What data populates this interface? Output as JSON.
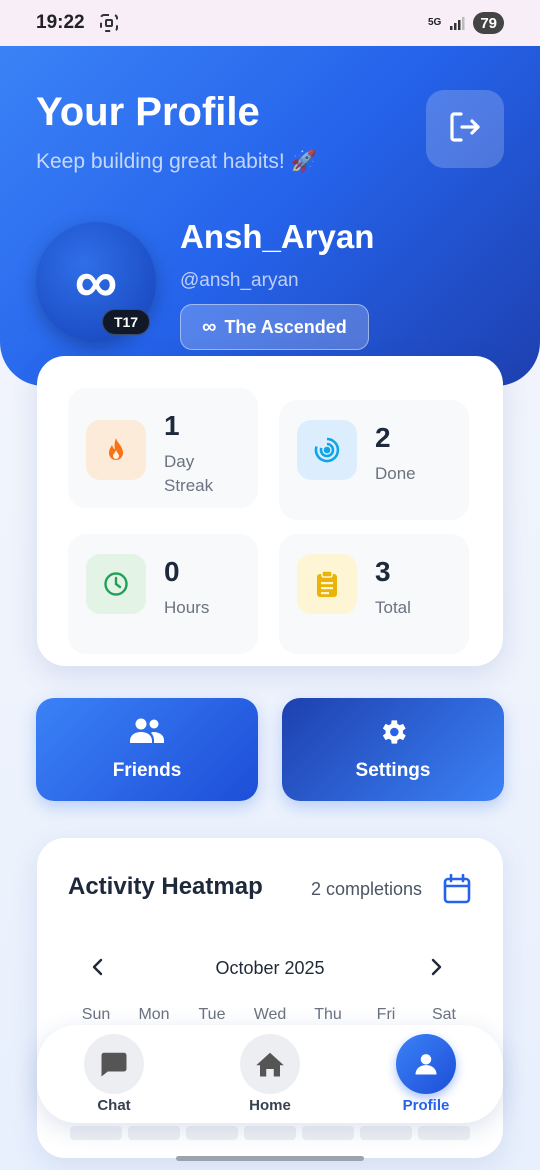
{
  "status_bar": {
    "time": "19:22",
    "network": "5G",
    "battery": "79"
  },
  "header": {
    "title": "Your Profile",
    "subtitle": "Keep building great habits! 🚀",
    "logout_icon": "logout-icon"
  },
  "profile": {
    "avatar_symbol": "∞",
    "tier": "T17",
    "name": "Ansh_Aryan",
    "handle": "@ansh_aryan",
    "rank_icon": "∞",
    "rank": "The Ascended"
  },
  "stats": [
    {
      "value": "1",
      "label_line1": "Day",
      "label_line2": "Streak",
      "icon": "fire-icon",
      "color": "#f97316"
    },
    {
      "value": "2",
      "label_line1": "Done",
      "label_line2": "",
      "icon": "target-icon",
      "color": "#0ea5e9"
    },
    {
      "value": "0",
      "label_line1": "Hours",
      "label_line2": "",
      "icon": "clock-icon",
      "color": "#22a05a"
    },
    {
      "value": "3",
      "label_line1": "Total",
      "label_line2": "",
      "icon": "clipboard-icon",
      "color": "#eab308"
    }
  ],
  "actions": {
    "friends_label": "Friends",
    "settings_label": "Settings"
  },
  "heatmap": {
    "title": "Activity Heatmap",
    "count": "2 completions",
    "month": "October 2025",
    "days": [
      "Sun",
      "Mon",
      "Tue",
      "Wed",
      "Thu",
      "Fri",
      "Sat"
    ]
  },
  "nav": {
    "items": [
      {
        "label": "Chat",
        "icon": "chat-icon"
      },
      {
        "label": "Home",
        "icon": "home-icon"
      },
      {
        "label": "Profile",
        "icon": "person-icon",
        "active": true
      }
    ]
  },
  "colors": {
    "primary": "#2563eb",
    "primary_dark": "#1e40af"
  }
}
